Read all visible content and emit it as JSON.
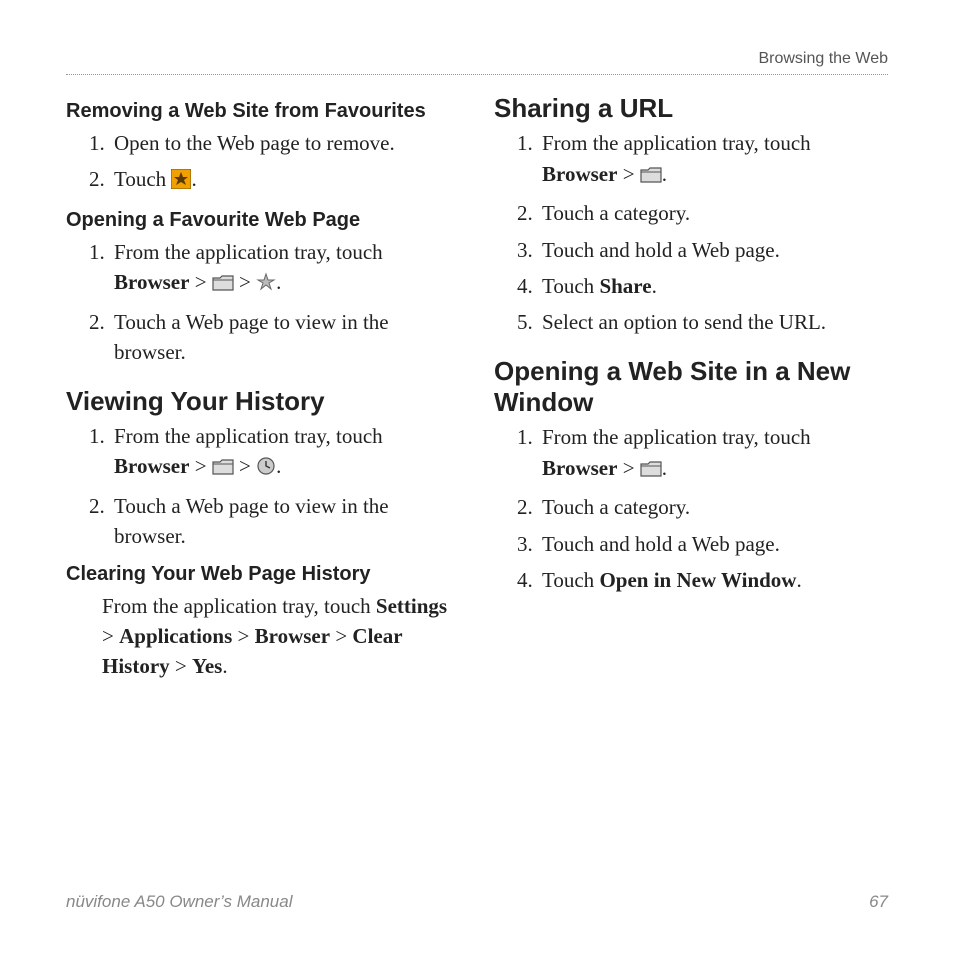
{
  "header": {
    "section": "Browsing the Web"
  },
  "left": {
    "s1": {
      "title": "Removing a Web Site from Favourites",
      "step1": "Open to the Web page to remove.",
      "step2a": "Touch ",
      "step2b": "."
    },
    "s2": {
      "title": "Opening a Favourite Web Page",
      "step1a": "From the application tray, touch ",
      "step1b": "Browser",
      "step1c": " > ",
      "step1d": " > ",
      "step1e": ".",
      "step2": "Touch a Web page to view in the browser."
    },
    "s3": {
      "title": "Viewing Your History",
      "step1a": "From the application tray, touch ",
      "step1b": "Browser",
      "step1c": " > ",
      "step1d": " > ",
      "step1e": ".",
      "step2": "Touch a Web page to view in the browser."
    },
    "s4": {
      "title": "Clearing Your Web Page History",
      "p1": "From the application tray, touch ",
      "p2": "Settings",
      "p3": " > ",
      "p4": "Applications",
      "p5": " > ",
      "p6": "Browser",
      "p7": " > ",
      "p8": "Clear History",
      "p9": " > ",
      "p10": "Yes",
      "p11": "."
    }
  },
  "right": {
    "s1": {
      "title": "Sharing a URL",
      "step1a": "From the application tray, touch ",
      "step1b": "Browser",
      "step1c": " > ",
      "step1d": ".",
      "step2": "Touch a category.",
      "step3": "Touch and hold a Web page.",
      "step4a": "Touch ",
      "step4b": "Share",
      "step4c": ".",
      "step5": "Select an option to send the URL."
    },
    "s2": {
      "title": "Opening a Web Site in a New Window",
      "step1a": "From the application tray, touch ",
      "step1b": "Browser",
      "step1c": " > ",
      "step1d": ".",
      "step2": "Touch a category.",
      "step3": "Touch and hold a Web page.",
      "step4a": "Touch ",
      "step4b": "Open in New Window",
      "step4c": "."
    }
  },
  "footer": {
    "book": "nüvifone A50 Owner’s Manual",
    "page": "67"
  }
}
